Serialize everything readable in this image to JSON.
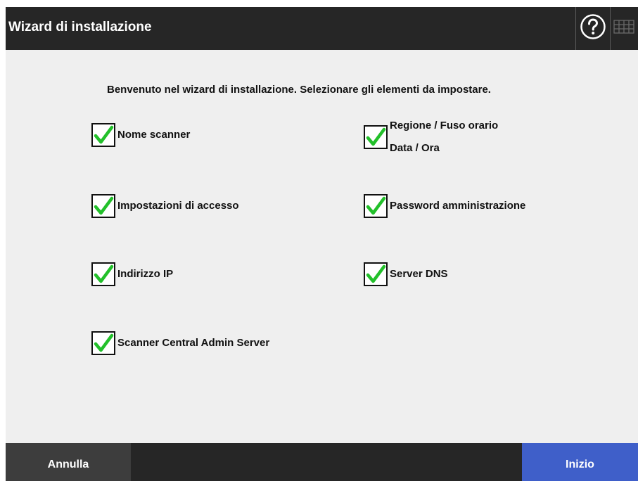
{
  "window": {
    "title": "Wizard di installazione",
    "help_icon": "question-circle-icon",
    "keyboard_icon": "keyboard-icon"
  },
  "main": {
    "intro": "Benvenuto nel wizard di installazione. Selezionare gli elementi da impostare.",
    "options": {
      "scanner_name": {
        "label": "Nome scanner",
        "checked": true
      },
      "region": {
        "label_line1": "Regione / Fuso orario",
        "label_line2": "Data / Ora",
        "checked": true
      },
      "access_settings": {
        "label": "Impostazioni di accesso",
        "checked": true
      },
      "admin_password": {
        "label": "Password amministrazione",
        "checked": true
      },
      "ip_address": {
        "label": "Indirizzo IP",
        "checked": true
      },
      "dns_server": {
        "label": "Server DNS",
        "checked": true
      },
      "central_admin": {
        "label": "Scanner Central Admin Server",
        "checked": true
      }
    }
  },
  "footer": {
    "cancel_label": "Annulla",
    "start_label": "Inizio"
  },
  "colors": {
    "titlebar": "#262626",
    "background": "#efefef",
    "check_green": "#22c02a",
    "start_button": "#3f5fc9",
    "cancel_button": "#3d3d3d"
  }
}
